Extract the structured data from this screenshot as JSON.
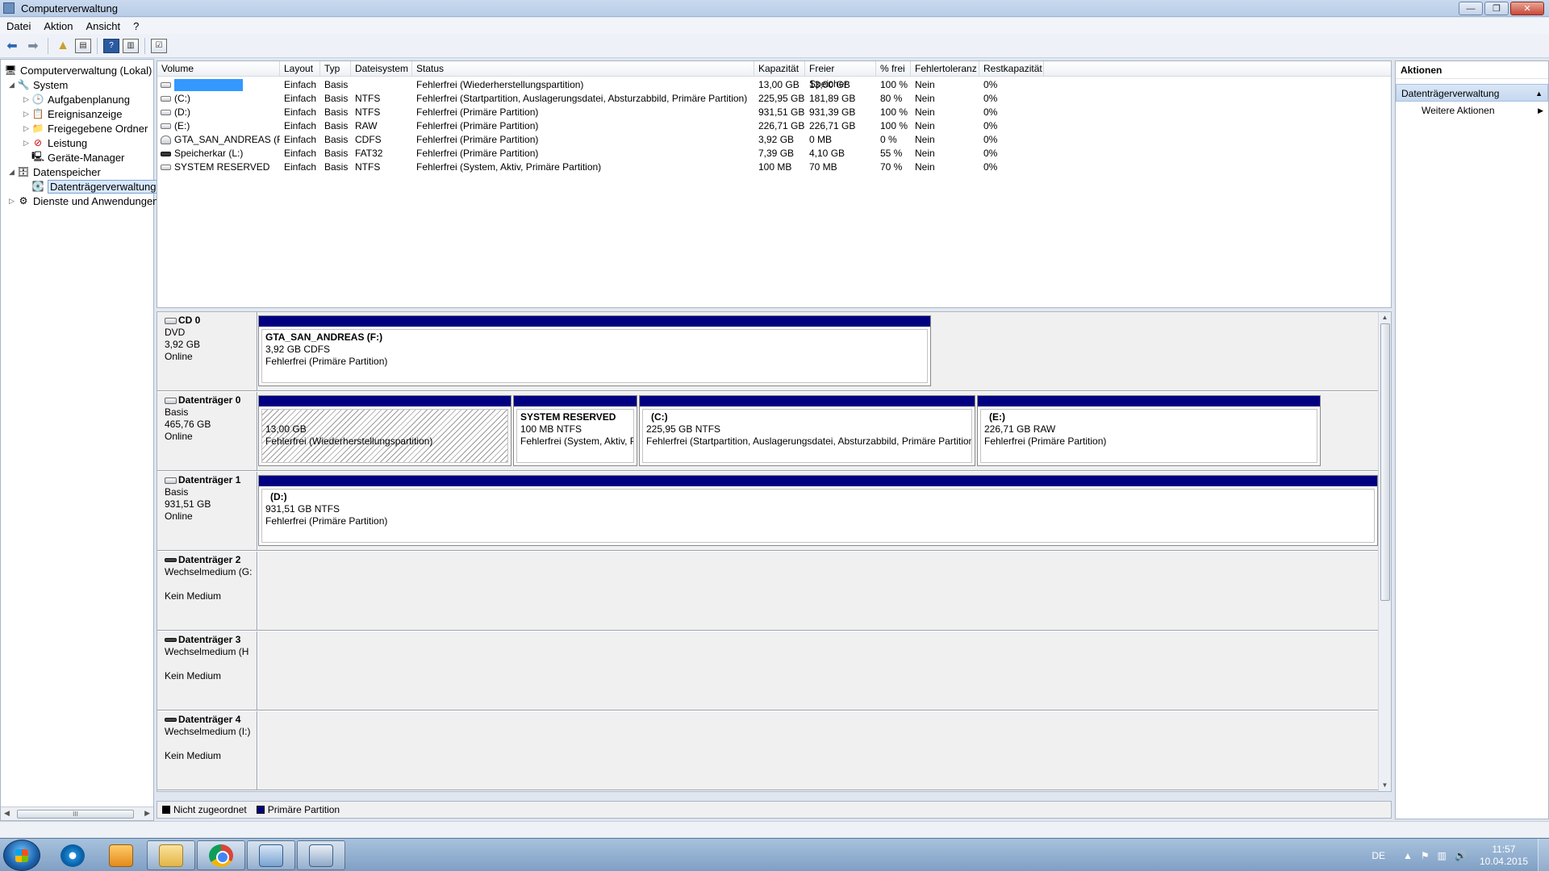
{
  "window": {
    "title": "Computerverwaltung",
    "btn_min": "—",
    "btn_max": "❐",
    "btn_close": "✕"
  },
  "menu": [
    "Datei",
    "Aktion",
    "Ansicht",
    "?"
  ],
  "tree": {
    "root": "Computerverwaltung (Lokal)",
    "system": "System",
    "aufgabenplanung": "Aufgabenplanung",
    "ereignisanzeige": "Ereignisanzeige",
    "freigegebene_ordner": "Freigegebene Ordner",
    "leistung": "Leistung",
    "geraete_manager": "Geräte-Manager",
    "datenspeicher": "Datenspeicher",
    "datentraegerverwaltung": "Datenträgerverwaltung",
    "dienste": "Dienste und Anwendungen",
    "scroll_grip": "III"
  },
  "list": {
    "columns": [
      "Volume",
      "Layout",
      "Typ",
      "Dateisystem",
      "Status",
      "Kapazität",
      "Freier Speicher",
      "% frei",
      "Fehlertoleranz",
      "Restkapazität"
    ],
    "rows": [
      {
        "volume": "",
        "layout": "Einfach",
        "typ": "Basis",
        "fs": "",
        "status": "Fehlerfrei (Wiederherstellungspartition)",
        "kap": "13,00 GB",
        "frei": "13,00 GB",
        "pct": "100 %",
        "ft": "Nein",
        "rest": "0%"
      },
      {
        "volume": "(C:)",
        "layout": "Einfach",
        "typ": "Basis",
        "fs": "NTFS",
        "status": "Fehlerfrei (Startpartition, Auslagerungsdatei, Absturzabbild, Primäre Partition)",
        "kap": "225,95 GB",
        "frei": "181,89 GB",
        "pct": "80 %",
        "ft": "Nein",
        "rest": "0%"
      },
      {
        "volume": "(D:)",
        "layout": "Einfach",
        "typ": "Basis",
        "fs": "NTFS",
        "status": "Fehlerfrei (Primäre Partition)",
        "kap": "931,51 GB",
        "frei": "931,39 GB",
        "pct": "100 %",
        "ft": "Nein",
        "rest": "0%"
      },
      {
        "volume": "(E:)",
        "layout": "Einfach",
        "typ": "Basis",
        "fs": "RAW",
        "status": "Fehlerfrei (Primäre Partition)",
        "kap": "226,71 GB",
        "frei": "226,71 GB",
        "pct": "100 %",
        "ft": "Nein",
        "rest": "0%"
      },
      {
        "volume": "GTA_SAN_ANDREAS (F:)",
        "layout": "Einfach",
        "typ": "Basis",
        "fs": "CDFS",
        "status": "Fehlerfrei (Primäre Partition)",
        "kap": "3,92 GB",
        "frei": "0 MB",
        "pct": "0 %",
        "ft": "Nein",
        "rest": "0%"
      },
      {
        "volume": "Speicherkar (L:)",
        "layout": "Einfach",
        "typ": "Basis",
        "fs": "FAT32",
        "status": "Fehlerfrei (Primäre Partition)",
        "kap": "7,39 GB",
        "frei": "4,10 GB",
        "pct": "55 %",
        "ft": "Nein",
        "rest": "0%"
      },
      {
        "volume": "SYSTEM RESERVED",
        "layout": "Einfach",
        "typ": "Basis",
        "fs": "NTFS",
        "status": "Fehlerfrei (System, Aktiv, Primäre Partition)",
        "kap": "100 MB",
        "frei": "70 MB",
        "pct": "70 %",
        "ft": "Nein",
        "rest": "0%"
      }
    ]
  },
  "disks": {
    "cd0": {
      "name": "CD 0",
      "type": "DVD",
      "size": "3,92 GB",
      "state": "Online",
      "p1": {
        "name": "GTA_SAN_ANDREAS  (F:)",
        "info": "3,92 GB CDFS",
        "status": "Fehlerfrei (Primäre Partition)"
      }
    },
    "d0": {
      "name": "Datenträger 0",
      "type": "Basis",
      "size": "465,76 GB",
      "state": "Online",
      "p1": {
        "info": "13,00 GB",
        "status": "Fehlerfrei (Wiederherstellungspartition)"
      },
      "p2": {
        "name": "SYSTEM RESERVED",
        "info": "100 MB NTFS",
        "status": "Fehlerfrei (System, Aktiv, P"
      },
      "p3": {
        "name": "(C:)",
        "info": "225,95 GB NTFS",
        "status": "Fehlerfrei (Startpartition, Auslagerungsdatei, Absturzabbild, Primäre Partition"
      },
      "p4": {
        "name": "(E:)",
        "info": "226,71 GB RAW",
        "status": "Fehlerfrei (Primäre Partition)"
      }
    },
    "d1": {
      "name": "Datenträger 1",
      "type": "Basis",
      "size": "931,51 GB",
      "state": "Online",
      "p1": {
        "name": "(D:)",
        "info": "931,51 GB NTFS",
        "status": "Fehlerfrei (Primäre Partition)"
      }
    },
    "d2": {
      "name": "Datenträger 2",
      "type": "Wechselmedium (G:",
      "state": "Kein Medium"
    },
    "d3": {
      "name": "Datenträger 3",
      "type": "Wechselmedium (H",
      "state": "Kein Medium"
    },
    "d4": {
      "name": "Datenträger 4",
      "type": "Wechselmedium (I:)",
      "state": "Kein Medium"
    }
  },
  "legend": {
    "unallocated": "Nicht zugeordnet",
    "primary": "Primäre Partition",
    "unallocated_color": "#000000",
    "primary_color": "#000080"
  },
  "actions": {
    "header": "Aktionen",
    "group": "Datenträgerverwaltung",
    "more": "Weitere Aktionen"
  },
  "taskbar": {
    "lang": "DE",
    "time": "11:57",
    "date": "10.04.2015"
  },
  "colors": {
    "partition_bar": "#000080",
    "selection": "#3399ff"
  }
}
